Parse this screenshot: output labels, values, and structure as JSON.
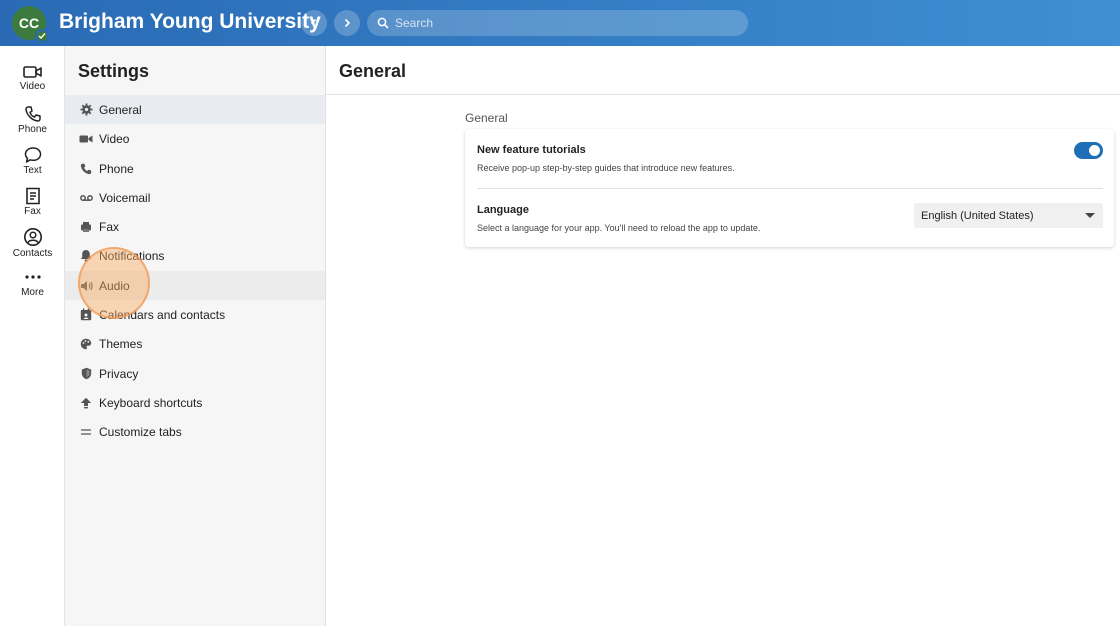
{
  "header": {
    "avatar_initials": "CC",
    "org_title": "Brigham Young University",
    "search_placeholder": "Search"
  },
  "rail": {
    "items": [
      {
        "label": "Video",
        "icon": "video-icon"
      },
      {
        "label": "Phone",
        "icon": "phone-icon"
      },
      {
        "label": "Text",
        "icon": "chat-bubble-icon"
      },
      {
        "label": "Fax",
        "icon": "fax-icon"
      },
      {
        "label": "Contacts",
        "icon": "person-icon"
      },
      {
        "label": "More",
        "icon": "more-dots-icon"
      }
    ]
  },
  "settings": {
    "title": "Settings",
    "items": [
      {
        "label": "General",
        "icon": "gear-icon",
        "active": true
      },
      {
        "label": "Video",
        "icon": "video-icon"
      },
      {
        "label": "Phone",
        "icon": "phone-icon"
      },
      {
        "label": "Voicemail",
        "icon": "voicemail-icon"
      },
      {
        "label": "Fax",
        "icon": "fax-icon"
      },
      {
        "label": "Notifications",
        "icon": "bell-icon"
      },
      {
        "label": "Audio",
        "icon": "speaker-icon",
        "hover": true
      },
      {
        "label": "Calendars and contacts",
        "icon": "calendar-icon"
      },
      {
        "label": "Themes",
        "icon": "palette-icon"
      },
      {
        "label": "Privacy",
        "icon": "shield-icon"
      },
      {
        "label": "Keyboard shortcuts",
        "icon": "keyboard-arrow-icon"
      },
      {
        "label": "Customize tabs",
        "icon": "lines-icon"
      }
    ]
  },
  "main": {
    "title": "General",
    "section_label": "General",
    "tutorials": {
      "title": "New feature tutorials",
      "description": "Receive pop-up step-by-step guides that introduce new features.",
      "enabled": true
    },
    "language": {
      "title": "Language",
      "description": "Select a language for your app. You'll need to reload the app to update.",
      "selected": "English (United States)"
    }
  },
  "colors": {
    "header_start": "#2a6ab5",
    "header_end": "#3f8fd3",
    "avatar": "#3d7a3d",
    "toggle_on": "#1f6fb8",
    "click_highlight": "#f8aa64"
  }
}
